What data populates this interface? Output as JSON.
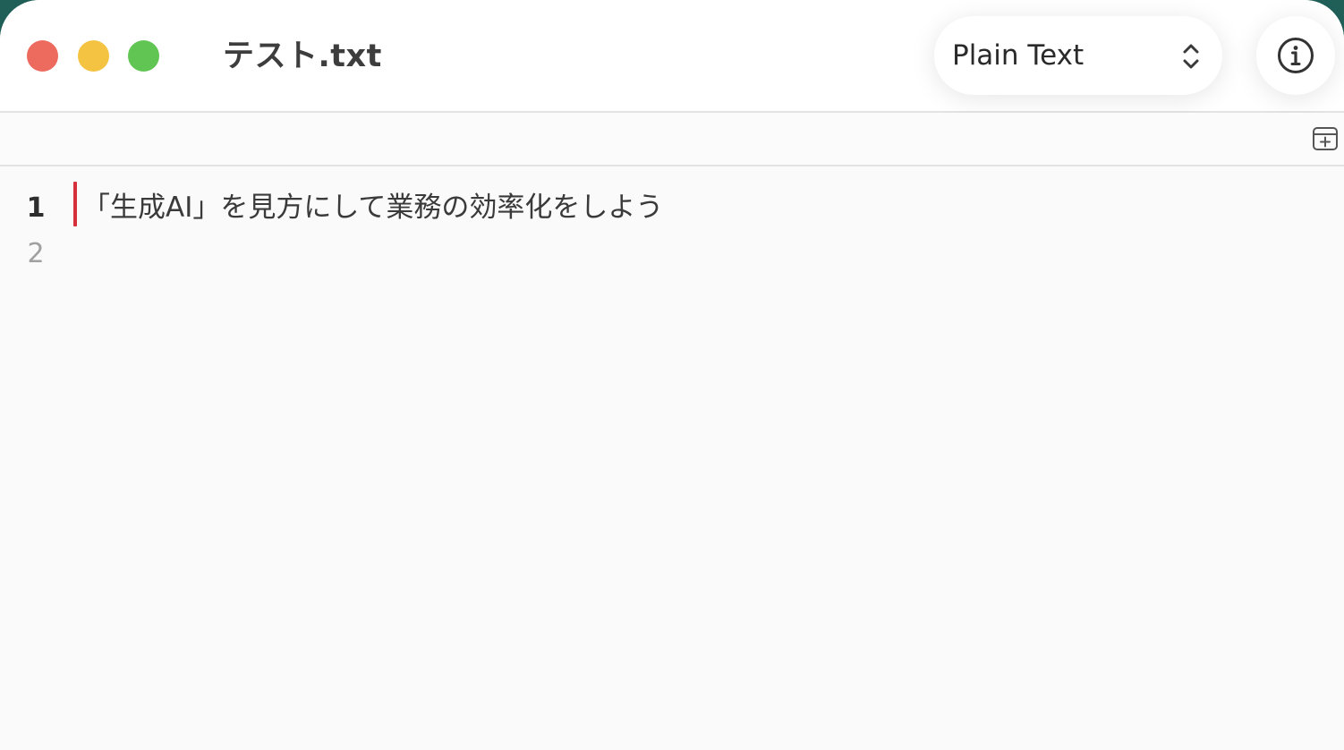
{
  "window": {
    "title": "テスト.txt"
  },
  "toolbar": {
    "language_select": {
      "value": "Plain Text",
      "icon": "chevron-up-down-icon"
    },
    "info_button": {
      "icon": "info-circle-icon"
    },
    "add_pane_button": {
      "icon": "add-pane-icon"
    }
  },
  "editor": {
    "lines": [
      {
        "number": "1",
        "text": "「生成AI」を見方にして業務の効率化をしよう"
      },
      {
        "number": "2",
        "text": ""
      }
    ],
    "cursor_color": "#d6313b"
  },
  "colors": {
    "close": "#ed6a5e",
    "minimize": "#f5c342",
    "maximize": "#61c554"
  }
}
